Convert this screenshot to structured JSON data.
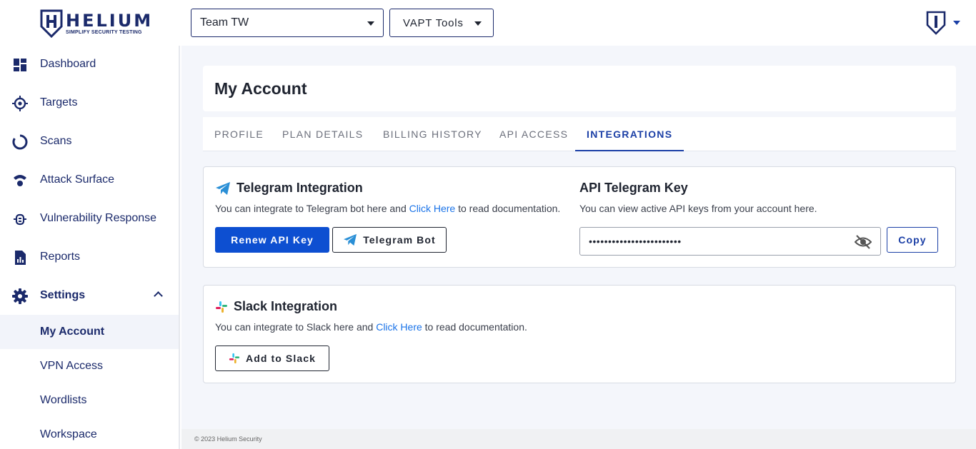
{
  "brand": {
    "name": "HELIUM",
    "tagline": "SIMPLIFY SECURITY TESTING",
    "color": "#1b2a6b"
  },
  "header": {
    "team_select": {
      "value": "Team TW"
    },
    "tools_select": {
      "value": "VAPT Tools"
    },
    "user_menu_icon": "shield-avatar-icon"
  },
  "sidebar": {
    "items": [
      {
        "label": "Dashboard",
        "icon": "dashboard-icon"
      },
      {
        "label": "Targets",
        "icon": "target-icon"
      },
      {
        "label": "Scans",
        "icon": "scans-icon"
      },
      {
        "label": "Attack Surface",
        "icon": "attack-surface-icon"
      },
      {
        "label": "Vulnerability Response",
        "icon": "bug-icon"
      },
      {
        "label": "Reports",
        "icon": "reports-icon"
      },
      {
        "label": "Settings",
        "icon": "gear-icon",
        "expanded": true
      }
    ],
    "settings_sub": [
      {
        "label": "My Account",
        "active": true
      },
      {
        "label": "VPN Access"
      },
      {
        "label": "Wordlists"
      },
      {
        "label": "Workspace"
      }
    ]
  },
  "page": {
    "title": "My Account"
  },
  "tabs": [
    {
      "label": "PROFILE"
    },
    {
      "label": "PLAN DETAILS"
    },
    {
      "label": "BILLING HISTORY"
    },
    {
      "label": "API ACCESS"
    },
    {
      "label": "INTEGRATIONS",
      "active": true
    }
  ],
  "telegram": {
    "title": "Telegram Integration",
    "desc_before": "You can integrate to Telegram bot here and ",
    "link": "Click Here",
    "desc_after": " to read documentation.",
    "renew_button": "Renew API Key",
    "bot_button": "Telegram Bot",
    "key_title": "API Telegram Key",
    "key_desc": "You can view active API keys from your account here.",
    "key_value": "••••••••••••••••••••••••",
    "copy_button": "Copy"
  },
  "slack": {
    "title": "Slack Integration",
    "desc_before": "You can integrate to Slack here and ",
    "link": "Click Here",
    "desc_after": " to read documentation.",
    "add_button": "Add to Slack"
  },
  "footer": {
    "text": "© 2023 Helium Security"
  },
  "colors": {
    "primary": "#0d4fd1",
    "accent": "#1b3fa6",
    "link": "#1a73e8",
    "background": "#f4f6fb"
  }
}
